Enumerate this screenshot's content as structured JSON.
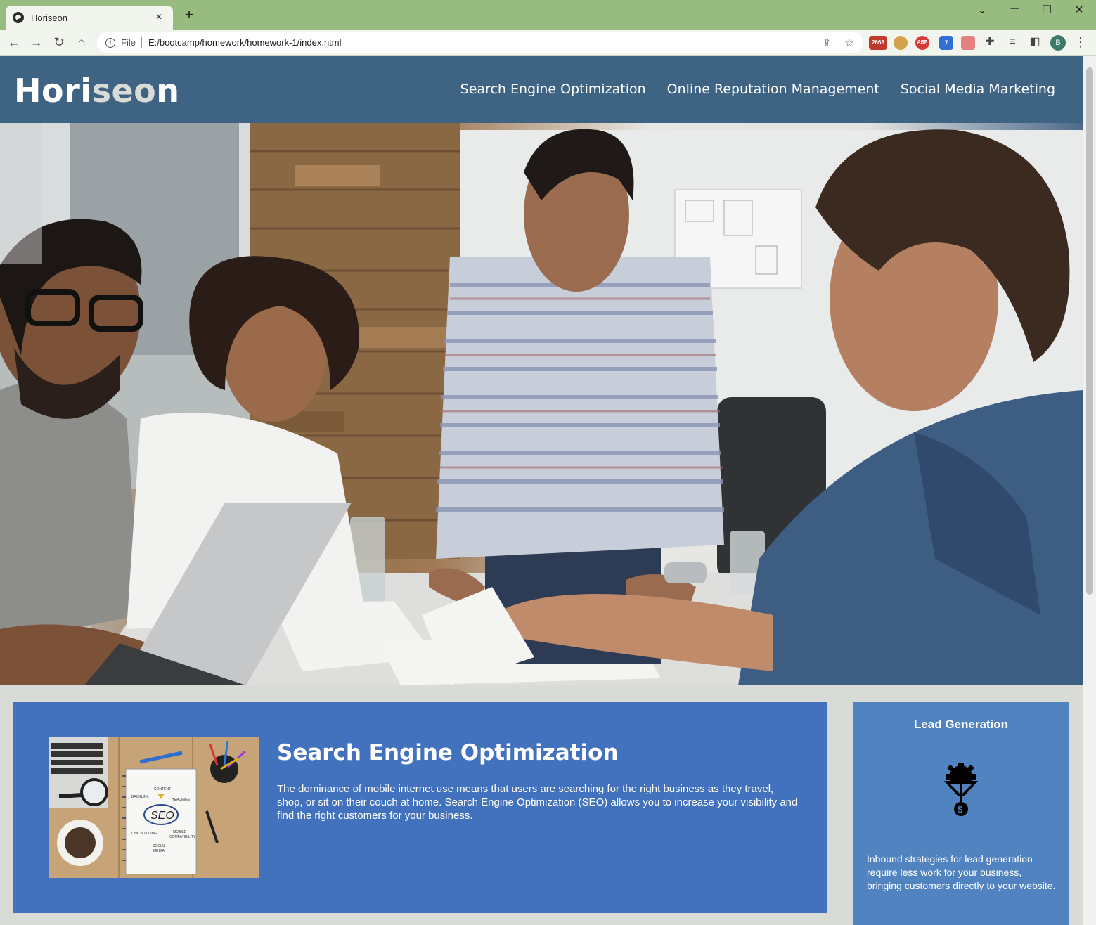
{
  "browser": {
    "tab_title": "Horiseon",
    "tab_close": "×",
    "new_tab": "+",
    "address_prefix": "File",
    "address_url": "E:/bootcamp/homework/homework-1/index.html",
    "controls": {
      "dropdown": "⌄",
      "minimize": "─",
      "maximize": "☐",
      "close": "✕"
    },
    "nav": {
      "back": "←",
      "forward": "→",
      "reload": "↻",
      "home": "⌂"
    },
    "omni_icons": {
      "share": "⇪",
      "bookmark": "☆"
    },
    "extensions": [
      {
        "name": "gmail-checker",
        "badge": "2668",
        "color": "#c0392b"
      },
      {
        "name": "cookie-extension",
        "badge": "",
        "color": "#d4a24c"
      },
      {
        "name": "adblock-plus",
        "badge": "ABP",
        "color": "#d93838"
      },
      {
        "name": "cast-extension",
        "badge": "7",
        "color": "#2f6fd6"
      },
      {
        "name": "screen-recorder",
        "badge": "",
        "color": "#e58080"
      }
    ],
    "profile_initial": "B"
  },
  "header": {
    "logo_part1": "Hori",
    "logo_part2": "seo",
    "logo_part3": "n",
    "nav": [
      {
        "label": "Search Engine Optimization"
      },
      {
        "label": "Online Reputation Management"
      },
      {
        "label": "Social Media Marketing"
      }
    ]
  },
  "main": {
    "seo": {
      "title": "Search Engine Optimization",
      "body": "The dominance of mobile internet use means that users are searching for the right business as they travel, shop, or sit on their couch at home. Search Engine Optimization (SEO) allows you to increase your visibility and find the right customers for your business.",
      "image_words": [
        "CONTENT",
        "BACKLINK",
        "HEADINGS",
        "SEO",
        "LINK BUILDING",
        "MOBILE",
        "COMPATIBILITY",
        "SOCIAL",
        "MEDIA"
      ]
    }
  },
  "aside": {
    "lead_generation": {
      "title": "Lead Generation",
      "body": "Inbound strategies for lead generation require less work for your business, bringing customers directly to your website."
    }
  }
}
